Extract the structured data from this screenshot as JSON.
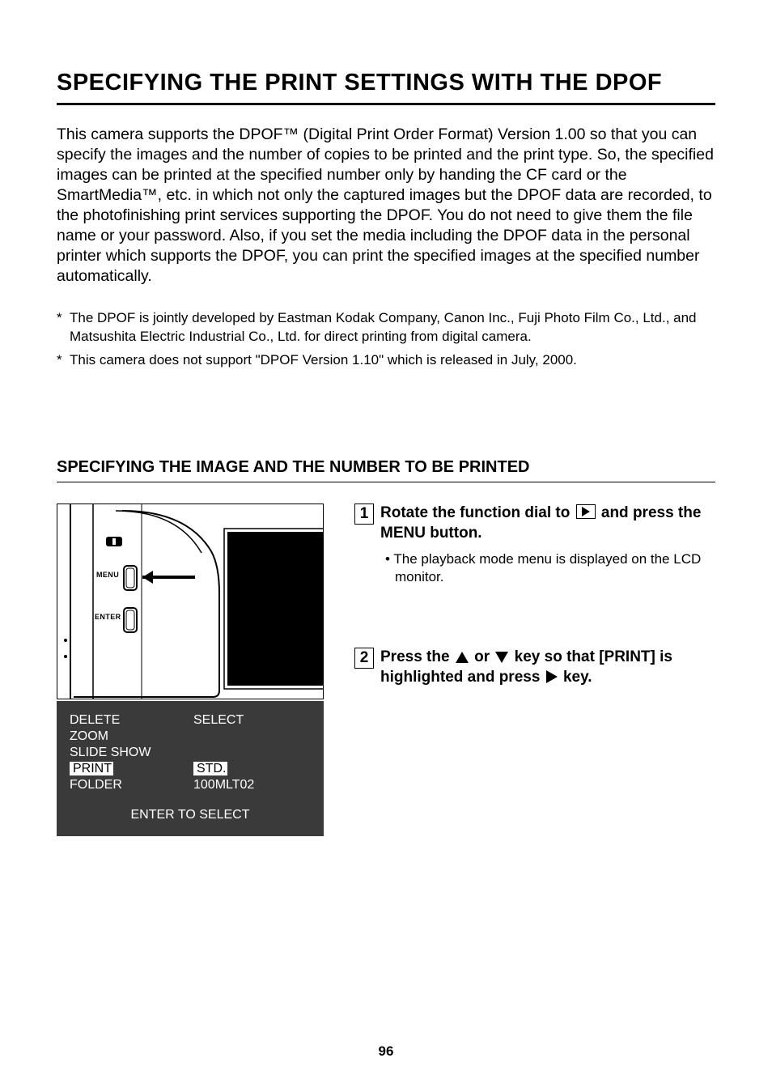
{
  "title": "SPECIFYING THE PRINT SETTINGS WITH THE DPOF",
  "intro": "This camera supports the DPOF™ (Digital Print Order Format) Version 1.00 so that you can specify the images and the number of copies to be printed and the print type. So, the specified images can be printed at the specified number only by handing the CF card or the SmartMedia™, etc. in which not only the captured images but the DPOF data are recorded, to the photofinishing print services supporting the DPOF. You do not need to give them the file name or your password. Also, if you set the media including the DPOF data in the personal printer which supports the DPOF, you can print the specified images at the specified number automatically.",
  "footnotes": [
    "The DPOF is jointly developed by Eastman Kodak Company, Canon Inc., Fuji Photo Film Co., Ltd., and Matsushita Electric Industrial Co., Ltd. for direct printing from digital camera.",
    "This camera does not support \"DPOF Version 1.10\" which is released in July, 2000."
  ],
  "subtitle": "SPECIFYING THE IMAGE AND THE NUMBER TO BE PRINTED",
  "camera_labels": {
    "menu": "MENU",
    "enter": "ENTER"
  },
  "lcd": {
    "rows": [
      {
        "left": "DELETE",
        "right": "SELECT",
        "hi_left": false,
        "hi_right": false
      },
      {
        "left": "ZOOM",
        "right": "",
        "hi_left": false,
        "hi_right": false
      },
      {
        "left": "SLIDE SHOW",
        "right": "",
        "hi_left": false,
        "hi_right": false
      },
      {
        "left": "PRINT",
        "right": "STD.",
        "hi_left": true,
        "hi_right": true
      },
      {
        "left": "FOLDER",
        "right": "100MLT02",
        "hi_left": false,
        "hi_right": false
      }
    ],
    "enter_line": "ENTER TO SELECT"
  },
  "steps": {
    "s1": {
      "num": "1",
      "text_pre": "Rotate the function dial to ",
      "text_post": " and press the MENU button.",
      "note": "• The playback mode menu is displayed on the LCD monitor."
    },
    "s2": {
      "num": "2",
      "text_pre": "Press the ",
      "text_mid1": " or ",
      "text_mid2": " key so that [PRINT] is highlighted and press ",
      "text_post": " key."
    }
  },
  "page_number": "96"
}
